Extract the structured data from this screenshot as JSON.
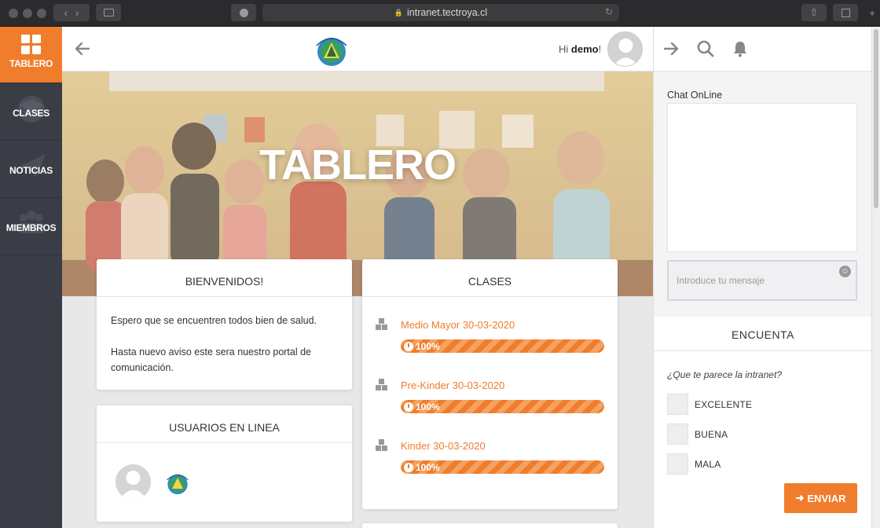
{
  "browser": {
    "url": "intranet.tectroya.cl"
  },
  "sidebar": {
    "items": [
      {
        "label": "TABLERO",
        "icon": "grid-icon"
      },
      {
        "label": "CLASES",
        "icon": "graduation-icon"
      },
      {
        "label": "NOTICIAS",
        "icon": "paper-plane-icon"
      },
      {
        "label": "MIEMBROS",
        "icon": "users-icon"
      }
    ]
  },
  "header": {
    "greeting": "Hi",
    "username": "demo",
    "exclamation": "!"
  },
  "hero": {
    "title": "TABLERO"
  },
  "welcome": {
    "title": "BIENVENIDOS!",
    "line1": "Espero que se encuentren todos bien de salud.",
    "line2": "Hasta nuevo aviso este sera nuestro portal de comunicación."
  },
  "online": {
    "title": "USUARIOS EN LINEA"
  },
  "classes": {
    "title": "CLASES",
    "items": [
      {
        "name": "Medio Mayor 30-03-2020",
        "progress": "100%",
        "fraction": 1.0
      },
      {
        "name": "Pre-Kinder 30-03-2020",
        "progress": "100%",
        "fraction": 1.0
      },
      {
        "name": "Kinder 30-03-2020",
        "progress": "100%",
        "fraction": 1.0
      }
    ]
  },
  "chat": {
    "title": "Chat OnLine",
    "placeholder": "Introduce tu mensaje"
  },
  "poll": {
    "title": "ENCUENTA",
    "question": "¿Que te parece la intranet?",
    "options": [
      "EXCELENTE",
      "BUENA",
      "MALA"
    ],
    "submit": "ENVIAR"
  },
  "colors": {
    "accent": "#ef7d2c",
    "sidebar": "#3a3d45"
  }
}
